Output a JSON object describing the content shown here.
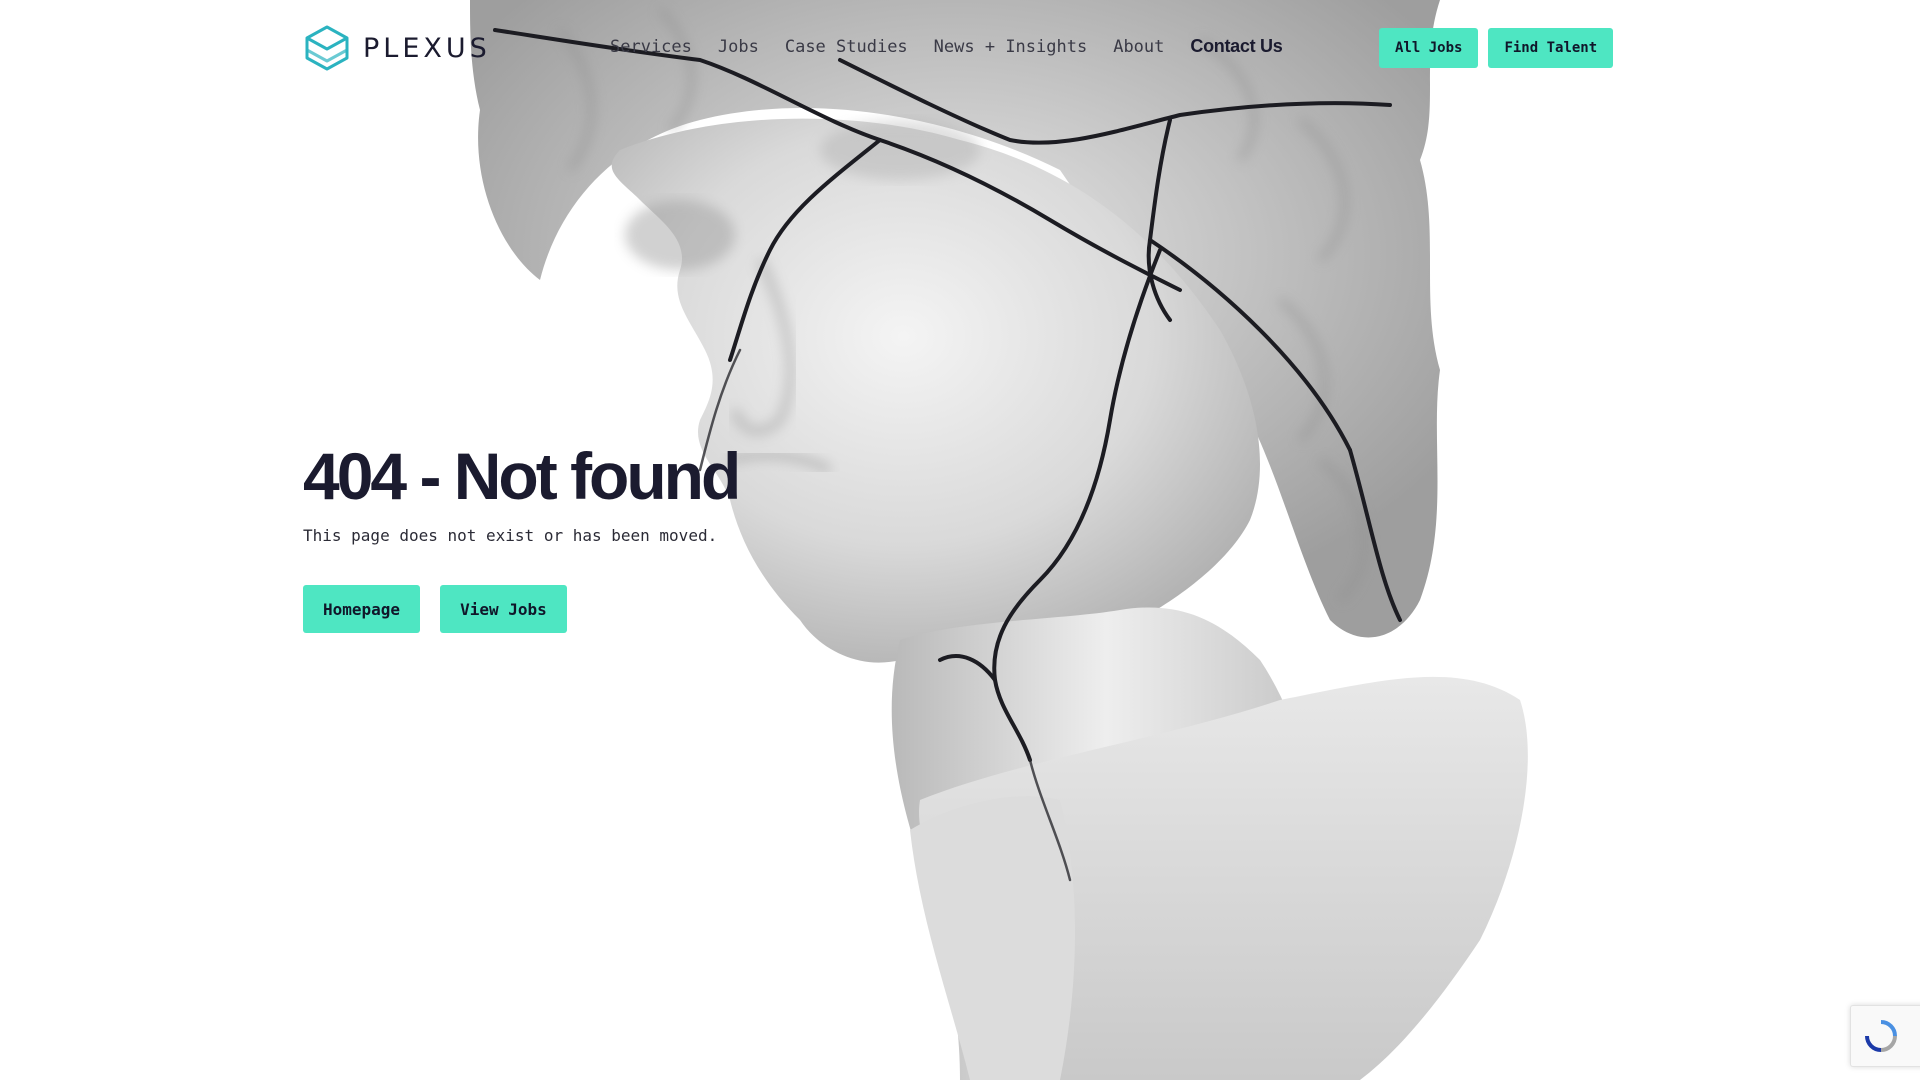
{
  "brand": {
    "name": "PLEXUS",
    "accent": "#4ee6c2",
    "logo_color": "#2bb3c0"
  },
  "nav": {
    "items": [
      {
        "label": "Services"
      },
      {
        "label": "Jobs"
      },
      {
        "label": "Case Studies"
      },
      {
        "label": "News + Insights"
      },
      {
        "label": "About"
      },
      {
        "label": "Contact Us"
      }
    ]
  },
  "header_actions": {
    "all_jobs": "All Jobs",
    "find_talent": "Find Talent"
  },
  "main": {
    "title": "404 - Not found",
    "description": "This page does not exist or has been moved.",
    "buttons": {
      "homepage": "Homepage",
      "view_jobs": "View Jobs"
    }
  },
  "icons": {
    "logo": "hexagon-cube-icon",
    "recaptcha": "recaptcha-badge"
  }
}
